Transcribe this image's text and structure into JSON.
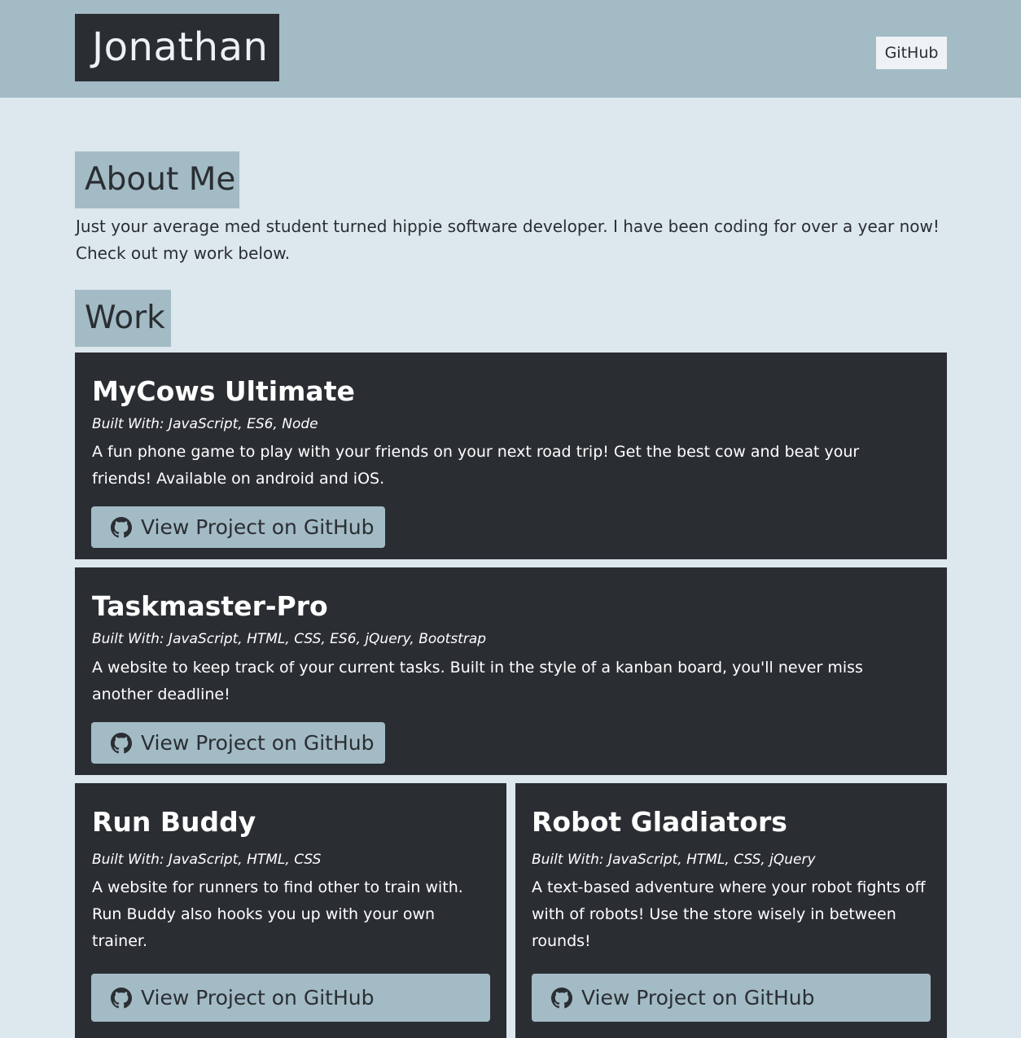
{
  "header": {
    "brand": "Jonathan",
    "nav_github": "GitHub"
  },
  "about": {
    "heading": "About Me",
    "text": "Just your average med student turned hippie software developer. I have been coding for over a year now! Check out my work below."
  },
  "work": {
    "heading": "Work",
    "projects": [
      {
        "title": "MyCows Ultimate",
        "built_with": "Built With: JavaScript, ES6, Node",
        "description": "A fun phone game to play with your friends on your next road trip! Get the best cow and beat your friends! Available on android and iOS.",
        "button_label": "View Project on GitHub",
        "button_icon": "github-icon"
      },
      {
        "title": "Taskmaster-Pro",
        "built_with": "Built With: JavaScript, HTML, CSS, ES6, jQuery, Bootstrap",
        "description": "A website to keep track of your current tasks. Built in the style of a kanban board, you'll never miss another deadline!",
        "button_label": "View Project on GitHub",
        "button_icon": "github-icon"
      },
      {
        "title": "Run Buddy",
        "built_with": "Built With: JavaScript, HTML, CSS",
        "description": "A website for runners to find other to train with. Run Buddy also hooks you up with your own trainer.",
        "button_label": "View Project on GitHub",
        "button_icon": "github-icon"
      },
      {
        "title": "Robot Gladiators",
        "built_with": "Built With: JavaScript, HTML, CSS, jQuery",
        "description": "A text-based adventure where your robot fights off with of robots! Use the store wisely in between rounds!",
        "button_label": "View Project on GitHub",
        "button_icon": "github-icon"
      }
    ]
  },
  "colors": {
    "page_background": "#dce7ee",
    "accent": "#a3bbc5",
    "dark": "#2a2e33",
    "light": "#eef2f4"
  }
}
